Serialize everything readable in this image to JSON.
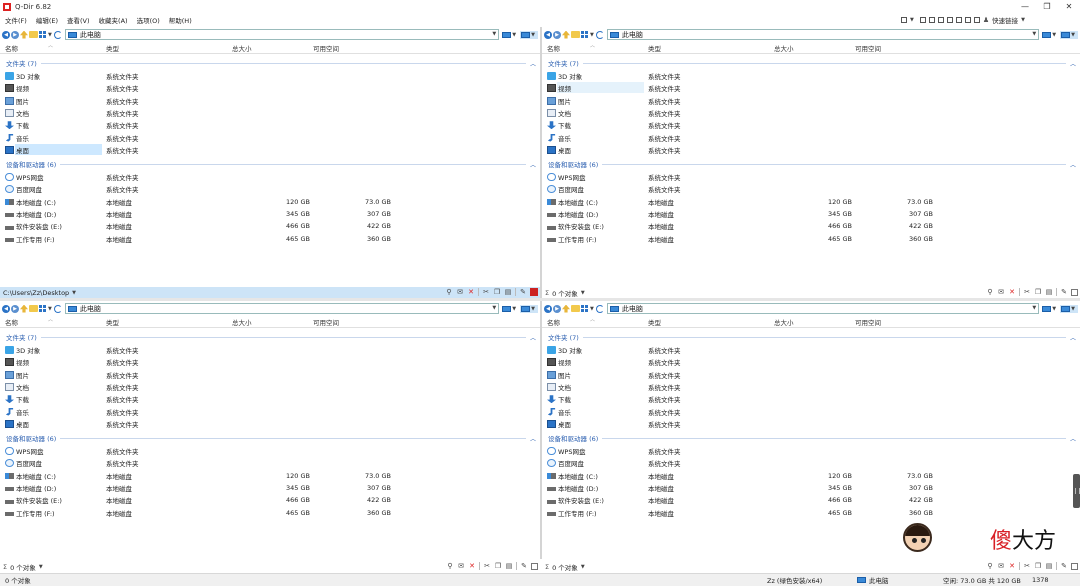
{
  "window": {
    "title": "Q-Dir 6.82",
    "controls": [
      "—",
      "❐",
      "✕"
    ]
  },
  "menu": [
    "文件(F)",
    "编辑(E)",
    "查看(V)",
    "收藏夹(A)",
    "选项(O)",
    "帮助(H)"
  ],
  "toolbar_right": {
    "label": "快速链接"
  },
  "address": "此电脑",
  "columns": {
    "name": "名称",
    "type": "类型",
    "total": "总大小",
    "free": "可用空间"
  },
  "groups": {
    "folders": "文件夹 (7)",
    "drives": "设备和驱动器 (6)"
  },
  "folders": [
    {
      "name": "3D 对象",
      "type": "系统文件夹",
      "icon": "cube-3d-icon"
    },
    {
      "name": "视频",
      "type": "系统文件夹",
      "icon": "video-icon"
    },
    {
      "name": "图片",
      "type": "系统文件夹",
      "icon": "picture-icon"
    },
    {
      "name": "文档",
      "type": "系统文件夹",
      "icon": "document-icon"
    },
    {
      "name": "下载",
      "type": "系统文件夹",
      "icon": "download-icon"
    },
    {
      "name": "音乐",
      "type": "系统文件夹",
      "icon": "music-icon"
    },
    {
      "name": "桌面",
      "type": "系统文件夹",
      "icon": "desktop-icon"
    }
  ],
  "drives": [
    {
      "name": "WPS网盘",
      "type": "系统文件夹",
      "total": "",
      "free": "",
      "icon": "cloud-icon"
    },
    {
      "name": "百度网盘",
      "type": "系统文件夹",
      "total": "",
      "free": "",
      "icon": "baidu-icon"
    },
    {
      "name": "本地磁盘 (C:)",
      "type": "本地磁盘",
      "total": "120 GB",
      "free": "73.0 GB",
      "icon": "system-drive-icon"
    },
    {
      "name": "本地磁盘 (D:)",
      "type": "本地磁盘",
      "total": "345 GB",
      "free": "307 GB",
      "icon": "drive-icon"
    },
    {
      "name": "软件安装盘 (E:)",
      "type": "本地磁盘",
      "total": "466 GB",
      "free": "422 GB",
      "icon": "drive-icon"
    },
    {
      "name": "工作专用 (F:)",
      "type": "本地磁盘",
      "total": "465 GB",
      "free": "360 GB",
      "icon": "drive-icon"
    }
  ],
  "pane_status": {
    "tl": "C:\\Users\\Zz\\Desktop",
    "tr": "0 个对象",
    "bl": "0 个对象",
    "br": "0 个对象"
  },
  "statusbar": {
    "objects": "0 个对象",
    "user": "Zz (绿色安装/x64)",
    "location": "此电脑",
    "space": "空闲: 73.0 GB 共 120 GB",
    "count": "1378"
  },
  "watermark": {
    "text_first": "傻",
    "text_rest": "大方"
  },
  "colors": {
    "accent": "#2b73c6",
    "selection": "#cde4f7",
    "group": "#2b5fb0"
  }
}
